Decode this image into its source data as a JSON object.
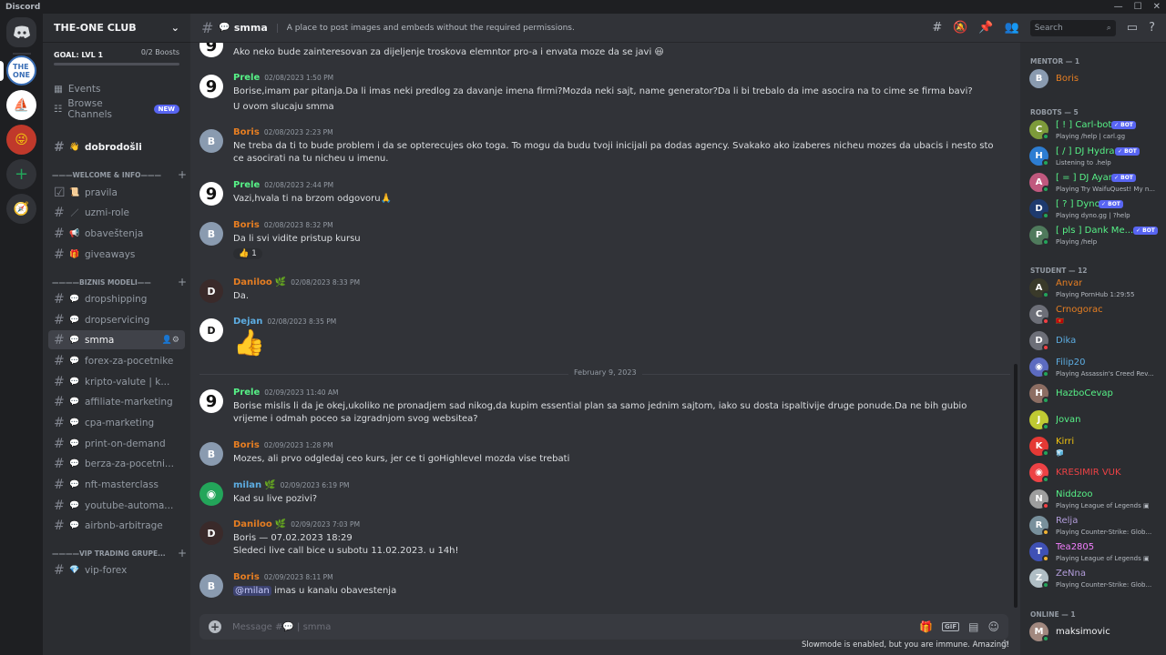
{
  "app": {
    "title": "Discord"
  },
  "server": {
    "name": "THE-ONE CLUB",
    "goal": "GOAL: LVL 1",
    "boosts": "0/2 Boosts"
  },
  "nav": {
    "events": "Events",
    "browse": "Browse Channels",
    "new_badge": "NEW"
  },
  "categories": {
    "welcome": "———WELCOME & INFO———",
    "biznis": "————BIZNIS MODELI——",
    "vip": "————VIP TRADING GRUPE..."
  },
  "channels": {
    "dobrodosli": "dobrodošli",
    "pravila": "pravila",
    "uzmi_role": "uzmi-role",
    "obavestenja": "obaveštenja",
    "giveaways": "giveaways",
    "dropshipping": "dropshipping",
    "dropservicing": "dropservicing",
    "smma": "smma",
    "forex": "forex-za-pocetnike",
    "kripto": "kripto-valute | k...",
    "affiliate": "affiliate-marketing",
    "cpa": "cpa-marketing",
    "pod": "print-on-demand",
    "berza": "berza-za-pocetni...",
    "nft": "nft-masterclass",
    "youtube": "youtube-automa...",
    "airbnb": "airbnb-arbitrage",
    "vipforex": "vip-forex"
  },
  "header": {
    "channel": "smma",
    "topic": "A place to post images and embeds without the required permissions.",
    "search": "Search"
  },
  "colors": {
    "boris": "#e67e22",
    "prele": "#57f287",
    "daniloo": "#e67e22",
    "dejan": "#5dade2",
    "milan": "#5dade2",
    "accent": "#5865f2"
  },
  "messages": [
    {
      "text": "Ako neko bude zainteresovan za dijeljenje troskova elemntor pro-a i envata moze da se javi 😃"
    },
    {
      "author": "Prele",
      "time": "02/08/2023 1:50 PM",
      "text": "Borise,imam par pitanja.Da li imas neki predlog za davanje imena firmi?Mozda neki sajt, name generator?Da li bi trebalo da ime asocira na to cime se firma bavi?",
      "text2": "U ovom slucaju smma"
    },
    {
      "author": "Boris",
      "time": "02/08/2023 2:23 PM",
      "text": "Ne treba da ti to bude problem i da se opterecujes oko toga. To mogu da budu tvoji inicijali pa dodas agency. Svakako ako izaberes nicheu mozes da ubacis i nesto sto ce asocirati na tu nicheu u imenu."
    },
    {
      "author": "Prele",
      "time": "02/08/2023 2:44 PM",
      "text": "Vazi,hvala ti na brzom odgovoru🙏"
    },
    {
      "author": "Boris",
      "time": "02/08/2023 8:32 PM",
      "text": "Da li svi vidite pristup kursu",
      "reaction": "👍  1"
    },
    {
      "author": "Daniloo",
      "time": "02/08/2023 8:33 PM",
      "text": "Da."
    },
    {
      "author": "Dejan",
      "time": "02/08/2023 8:35 PM",
      "text": "👍"
    },
    {
      "author": "Prele",
      "time": "02/09/2023 11:40 AM",
      "text": "Borise mislis li da je okej,ukoliko ne pronadjem sad nikog,da kupim essential plan sa samo jednim sajtom, iako su dosta ispaltivije druge ponude.Da ne bih gubio vrijeme i odmah poceo sa izgradnjom svog websitea?"
    },
    {
      "author": "Boris",
      "time": "02/09/2023 1:28 PM",
      "text": "Mozes, ali prvo odgledaj ceo kurs, jer ce ti goHighlevel mozda vise trebati"
    },
    {
      "author": "milan",
      "time": "02/09/2023 6:19 PM",
      "text": "Kad su live pozivi?"
    },
    {
      "author": "Daniloo",
      "time": "02/09/2023 7:03 PM",
      "text": "Boris — 07.02.2023 18:29",
      "text2": "Sledeci live call bice u subotu 11.02.2023. u 14h!"
    },
    {
      "author": "Boris",
      "time": "02/09/2023 8:11 PM",
      "mention": "@milan",
      "text": " imas u kanalu obavestenja"
    }
  ],
  "date_divider": "February 9, 2023",
  "composer": {
    "placeholder": "Message #💬 | smma",
    "gif": "GIF"
  },
  "slowmode": "Slowmode is enabled, but you are immune. Amazing!",
  "member_groups": {
    "mentor": "MENTOR — 1",
    "robots": "ROBOTS — 5",
    "student": "STUDENT — 12",
    "online": "ONLINE — 1"
  },
  "members": [
    {
      "name": "Boris",
      "activity": ""
    },
    {
      "name": "[ ! ] Carl-bot",
      "activity": "Playing /help | carl.gg",
      "bot": "✓ BOT"
    },
    {
      "name": "[ / ] DJ Hydra",
      "activity": "Listening to .help",
      "bot": "✓ BOT"
    },
    {
      "name": "[ = ] DJ Ayana",
      "activity": "Playing Try WaifuQuest! My n...",
      "bot": "✓ BOT"
    },
    {
      "name": "[ ? ] Dyno",
      "activity": "Playing dyno.gg | ?help",
      "bot": "✓ BOT"
    },
    {
      "name": "[ pls ] Dank Me...",
      "activity": "Playing /help",
      "bot": "✓ BOT"
    },
    {
      "name": "Anvar",
      "activity": "Playing PornHub 1:29:55"
    },
    {
      "name": "Crnogorac",
      "activity": "🇲🇪"
    },
    {
      "name": "Dika",
      "activity": ""
    },
    {
      "name": "Filip20",
      "activity": "Playing Assassin's Creed Rev..."
    },
    {
      "name": "HazboCevap",
      "activity": ""
    },
    {
      "name": "Jovan",
      "activity": ""
    },
    {
      "name": "Kirri",
      "activity": "🧊"
    },
    {
      "name": "KRESIMIR VUK",
      "activity": ""
    },
    {
      "name": "Niddzoo",
      "activity": "Playing League of Legends ▣"
    },
    {
      "name": "Relja",
      "activity": "Playing Counter-Strike: Glob..."
    },
    {
      "name": "Tea2805",
      "activity": "Playing League of Legends ▣"
    },
    {
      "name": "ZeNna",
      "activity": "Playing Counter-Strike: Glob..."
    },
    {
      "name": "maksimovic",
      "activity": ""
    }
  ]
}
